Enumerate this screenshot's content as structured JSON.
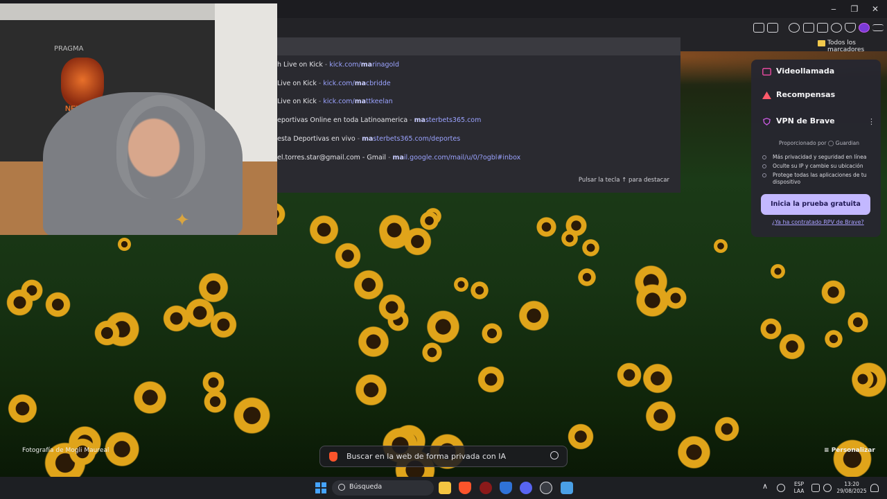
{
  "window": {
    "minimize": "‒",
    "restore": "❐",
    "close": "✕"
  },
  "bookmarks_bar": {
    "all_bookmarks": "Todos los marcadores"
  },
  "suggestions": [
    {
      "title": "h Live on Kick",
      "url_bold": "ma",
      "url_rest": "rinagold",
      "url_prefix": "kick.com/"
    },
    {
      "title": "Live on Kick",
      "url_bold": "ma",
      "url_rest": "cbridde",
      "url_prefix": "kick.com/"
    },
    {
      "title": "Live on Kick",
      "url_bold": "ma",
      "url_rest": "ttkeelan",
      "url_prefix": "kick.com/"
    },
    {
      "title": "eportivas Online en toda Latinoamerica",
      "url_bold": "ma",
      "url_rest": "sterbets365.com",
      "url_prefix": ""
    },
    {
      "title": "esta Deportivas en vivo",
      "url_bold": "ma",
      "url_rest": "sterbets365.com/deportes",
      "url_prefix": ""
    },
    {
      "title": "el.torres.star@gmail.com - Gmail",
      "url_bold": "ma",
      "url_rest": "il.google.com/mail/u/0/?ogbl#inbox",
      "url_prefix": ""
    }
  ],
  "suggest_hint": "Pulsar la tecla ↑ para destacar",
  "webcam": {
    "wall_text": "PRAGMA",
    "logo_text": "NEUTRO"
  },
  "brave_panel": {
    "videocall": "Videollamada",
    "rewards": "Recompensas",
    "vpn_title": "VPN de Brave",
    "more": "⋮",
    "provided_by": "Proporcionado por  ◯ Guardian",
    "features": [
      "Más privacidad y seguridad en línea",
      "Oculte su IP y cambie su ubicación",
      "Protege todas las aplicaciones de tu dispositivo"
    ],
    "cta": "Inicia la prueba gratuita",
    "link": "¿Ya ha contratado RPV de Brave?"
  },
  "photo_credit": "Fotografía de Mogli Maureal",
  "search": {
    "placeholder": "Buscar en la web de forma privada con IA"
  },
  "personalize": "Personalizar",
  "taskbar": {
    "search_label": "Búsqueda",
    "lang_top": "ESP",
    "lang_bottom": "LAA",
    "time": "13:20",
    "date": "29/08/2025",
    "chevron": "∧"
  }
}
